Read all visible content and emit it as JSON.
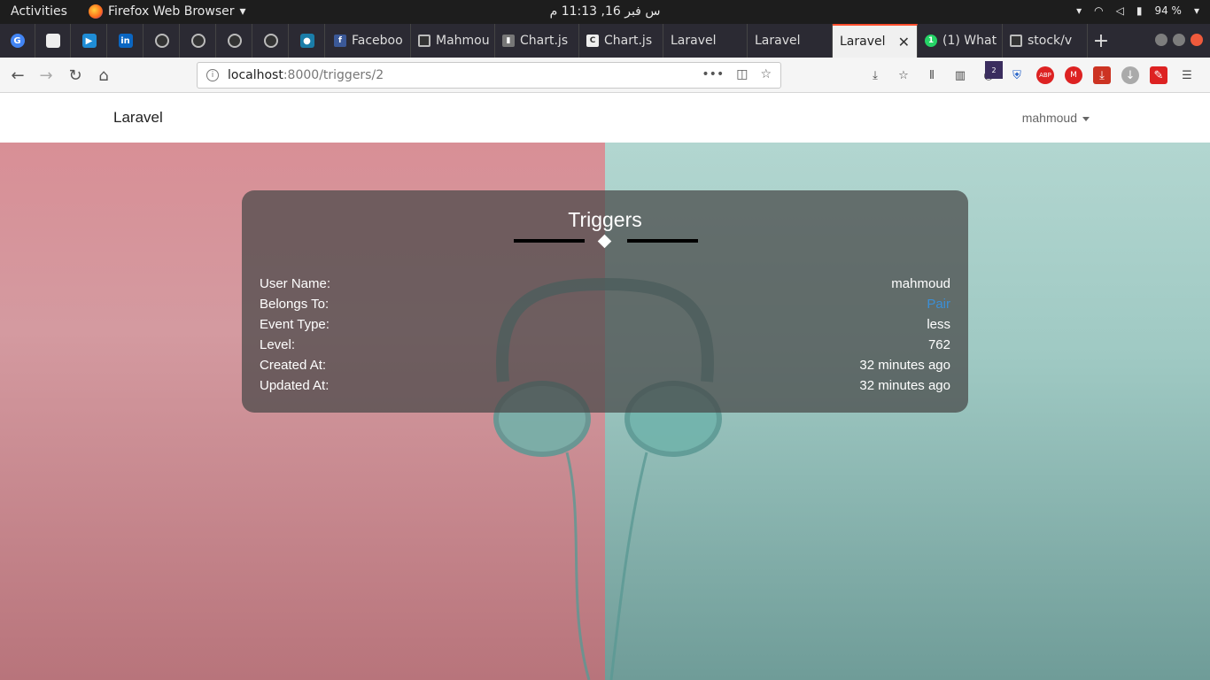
{
  "system_bar": {
    "activities": "Activities",
    "app_name": "Firefox Web Browser",
    "clock": "س فبر 16, 11:13 م",
    "battery": "94 %"
  },
  "tabs": [
    {
      "label": "Faceboo",
      "icon": "facebook-icon",
      "color": "#3b5998"
    },
    {
      "label": "Mahmou",
      "icon": "github-icon",
      "color": "#333333"
    },
    {
      "label": "Chart.js",
      "icon": "chartjs-icon",
      "color": "#555555"
    },
    {
      "label": "Chart.js",
      "icon": "c-icon",
      "color": "#555555"
    },
    {
      "label": "Laravel",
      "icon": "",
      "color": ""
    },
    {
      "label": "Laravel",
      "icon": "",
      "color": ""
    },
    {
      "label": "Laravel",
      "icon": "",
      "color": "",
      "active": true
    },
    {
      "label": "(1) What",
      "icon": "whatsapp-icon",
      "color": "#25d366"
    },
    {
      "label": "stock/v",
      "icon": "github-icon",
      "color": "#333333"
    }
  ],
  "url": {
    "host": "localhost",
    "path": ":8000/triggers/2"
  },
  "toolbar_badge": "2",
  "app": {
    "brand": "Laravel",
    "user": "mahmoud"
  },
  "card": {
    "title": "Triggers",
    "rows": [
      {
        "key": "User Name:",
        "value": "mahmoud"
      },
      {
        "key": "Belongs To:",
        "value": "Pair",
        "link": true
      },
      {
        "key": "Event Type:",
        "value": "less"
      },
      {
        "key": "Level:",
        "value": "762"
      },
      {
        "key": "Created At:",
        "value": "32 minutes ago"
      },
      {
        "key": "Updated At:",
        "value": "32 minutes ago"
      }
    ]
  },
  "colors": {
    "accent_tab": "#ff4f2e",
    "link": "#3b8fd6",
    "bg_left": "#d88f96",
    "bg_right": "#9fc9c3"
  }
}
